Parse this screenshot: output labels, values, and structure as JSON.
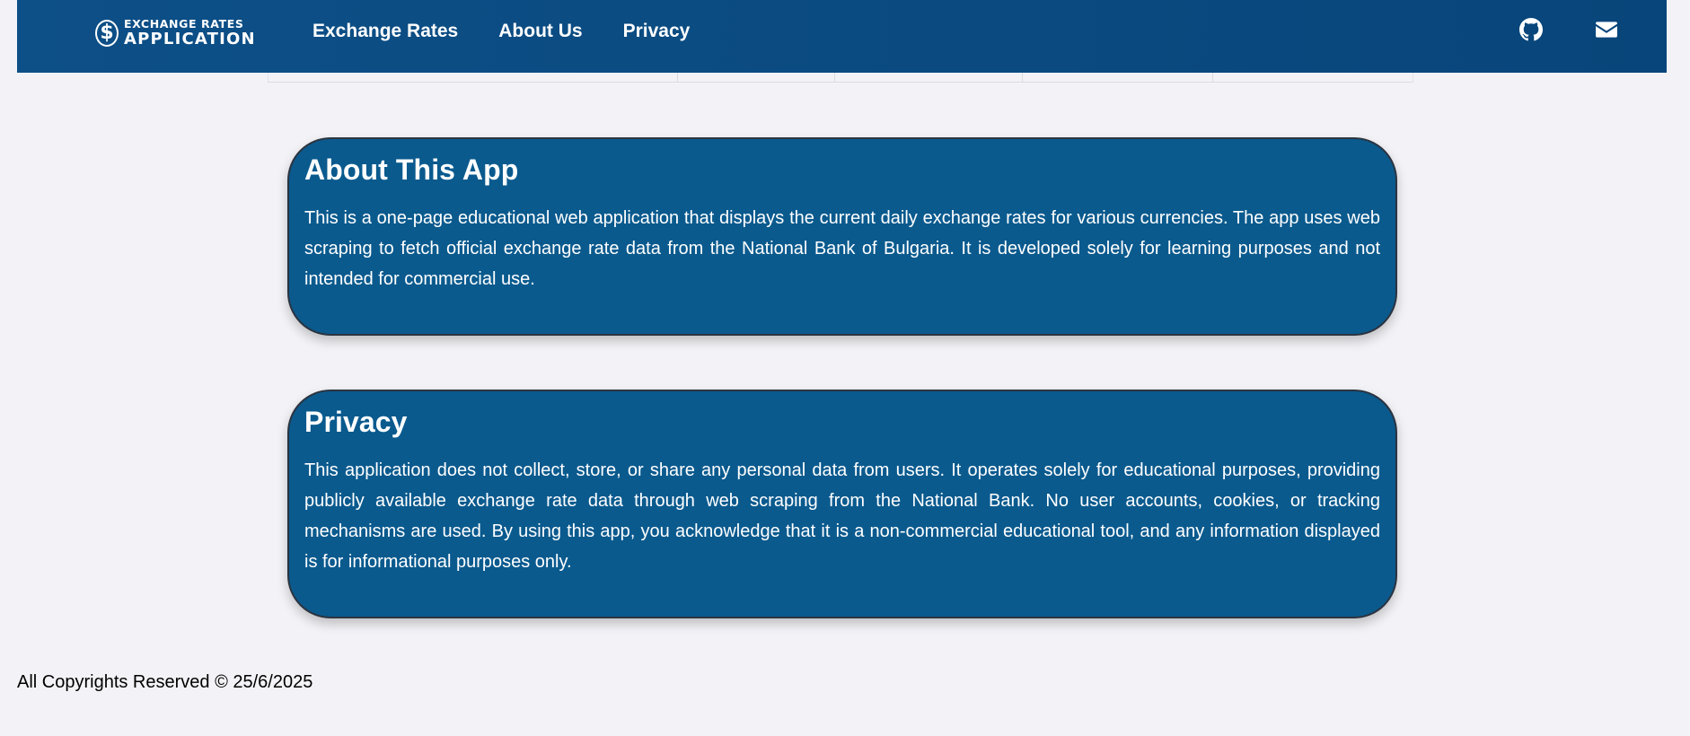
{
  "navbar": {
    "brand_line1": "EXCHANGE RATES",
    "brand_line2": "APPLICATION",
    "brand_symbol": "$",
    "links": [
      "Exchange Rates",
      "About Us",
      "Privacy"
    ],
    "icons": [
      "github-icon",
      "envelope-icon"
    ],
    "colors": {
      "background": "#0b4c84",
      "text": "#ffffff"
    }
  },
  "about": {
    "title": "About This App",
    "body": "This is a one-page educational web application that displays the current daily exchange rates for various currencies. The app uses web scraping to fetch official exchange rate data from the National Bank of Bulgaria. It is developed solely for learning purposes and not intended for commercial use."
  },
  "privacy": {
    "title": "Privacy",
    "body": "This application does not collect, store, or share any personal data from users. It operates solely for educational purposes, providing publicly available exchange rate data through web scraping from the National Bank. No user accounts, cookies, or tracking mechanisms are used. By using this app, you acknowledge that it is a non-commercial educational tool, and any information displayed is for informational purposes only."
  },
  "footer": {
    "text": "All Copyrights Reserved © 25/6/2025"
  },
  "theme": {
    "card_background": "#0a5a8e",
    "card_border": "#2b3440",
    "page_background": "#f3f3f7"
  }
}
